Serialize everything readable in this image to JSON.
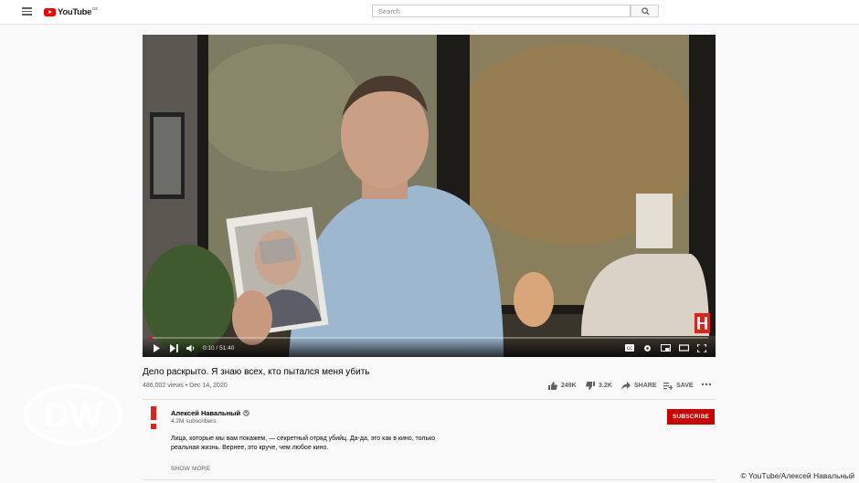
{
  "header": {
    "logo_text": "YouTube",
    "region": "DE",
    "search_placeholder": "Search"
  },
  "player": {
    "current_time": "0:10",
    "duration": "51:40",
    "time_display": "0:10 / 51:40",
    "progress_fraction": 0.003,
    "progress_color": "#ff0000"
  },
  "video": {
    "title": "Дело раскрыто. Я знаю всех, кто пытался меня убить",
    "meta": "486,002 views • Dec 14, 2020",
    "likes": "249K",
    "dislikes": "3.2K",
    "share_label": "SHARE",
    "save_label": "SAVE"
  },
  "channel": {
    "name": "Алексей Навальный",
    "subscribers": "4.2M subscribers",
    "subscribe_label": "SUBSCRIBE",
    "accent_color": "#cc0000",
    "description_line1": "Лица, которые мы вам покажем, — секретный отряд убийц. Да-да, это как в кино, только",
    "description_line2": "реальная жизнь. Вернее, это круче, чем любое кино.",
    "show_more_label": "SHOW MORE"
  },
  "overlay": {
    "watermark_text": "DW",
    "credit": "© YouTube/Алексей Навальный"
  }
}
